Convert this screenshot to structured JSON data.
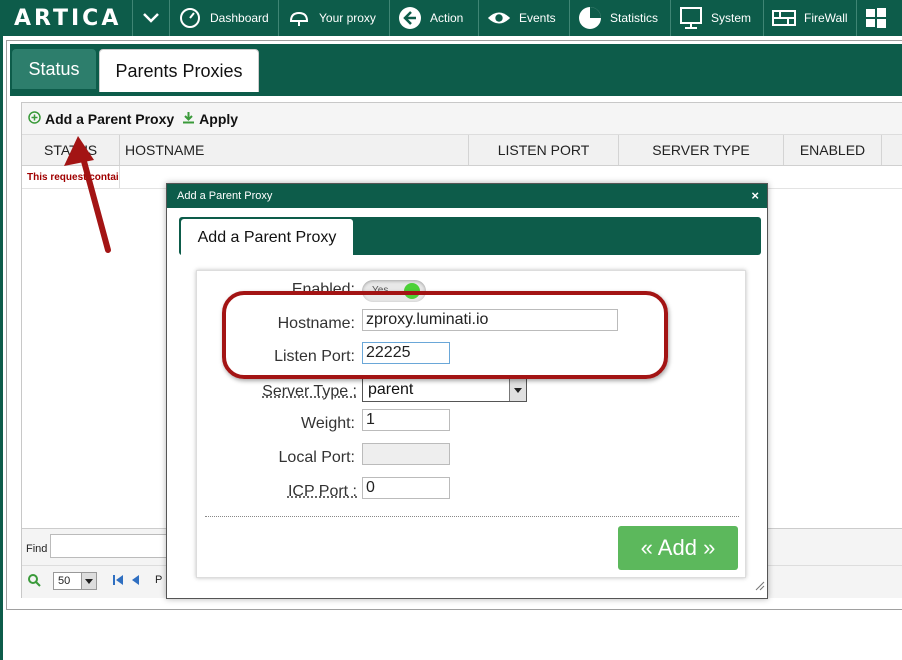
{
  "topbar": {
    "logo": "ARTICA",
    "items": [
      {
        "label": "Dashboard",
        "icon": "gauge-icon"
      },
      {
        "label": "Your proxy",
        "icon": "proxy-icon"
      },
      {
        "label": "Action",
        "icon": "back-arrow-icon"
      },
      {
        "label": "Events",
        "icon": "eye-icon"
      },
      {
        "label": "Statistics",
        "icon": "pie-chart-icon"
      },
      {
        "label": "System",
        "icon": "monitor-icon"
      },
      {
        "label": "FireWall",
        "icon": "firewall-icon"
      },
      {
        "label": "",
        "icon": "windows-icon"
      }
    ]
  },
  "tabs": {
    "status": "Status",
    "parents": "Parents Proxies"
  },
  "toolbar": {
    "add_label": "Add a Parent Proxy",
    "apply_label": "Apply"
  },
  "table": {
    "headers": [
      "STATUS",
      "HOSTNAME",
      "LISTEN PORT",
      "SERVER TYPE",
      "ENABLED"
    ],
    "row_message": "This request contai"
  },
  "footer": {
    "find_label": "Find",
    "page_size": "50",
    "pager_text": "P"
  },
  "dialog": {
    "title": "Add a Parent Proxy",
    "close": "×",
    "tab_label": "Add a Parent Proxy",
    "fields": {
      "enabled_label": "Enabled:",
      "enabled_value": "Yes",
      "hostname_label": "Hostname:",
      "hostname_value": "zproxy.luminati.io",
      "listen_port_label": "Listen Port:",
      "listen_port_value": "22225",
      "server_type_label": "Server Type :",
      "server_type_value": "parent",
      "weight_label": "Weight:",
      "weight_value": "1",
      "local_port_label": "Local Port:",
      "local_port_value": "",
      "icp_port_label": "ICP Port :",
      "icp_port_value": "0"
    },
    "add_button": "« Add »"
  },
  "colors": {
    "brand_green": "#0d5c4a",
    "button_green": "#5cb85c",
    "annotation_red": "#a31414"
  }
}
